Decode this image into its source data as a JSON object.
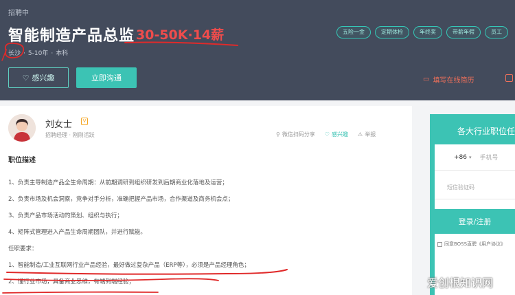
{
  "header": {
    "status": "招聘中",
    "title": "智能制造产品总监",
    "salary": "30-50K·14薪",
    "meta": {
      "city": "长沙",
      "experience": "5-10年",
      "education": "本科"
    },
    "tags": [
      "五险一金",
      "定期体检",
      "年终奖",
      "带薪年假",
      "员工"
    ],
    "interest_label": "感兴趣",
    "chat_label": "立即沟通",
    "fill_resume_label": "填写在线简历"
  },
  "recruiter": {
    "name": "刘女士",
    "role": "招聘经理",
    "activity": "刚刚活跃",
    "share_label": "微信扫码分享",
    "interest_label": "感兴趣",
    "report_label": "举报"
  },
  "description": {
    "section_title": "职位描述",
    "lines": [
      "1、负责主导制造产品全生命周期：从前期调研到组织研发到后期商业化落地及运营；",
      "2、负责市场及机会洞察，竞争对手分析，准确把握产品市场，合作渠道及商务机会点；",
      "3、负责产品市场活动的策划、组织与执行；",
      "4、矩阵式管理进入产品生命周期团队，并进行赋能。",
      "任职要求：",
      "1、智能制造/工业互联网行业产品经验，最好做过复杂产品（ERP等），必须是产品经理角色；",
      "2、懂行业市场，具备商业思维，有端到端经验；"
    ]
  },
  "sidebar": {
    "title": "各大行业职位任",
    "phone_code": "+86",
    "phone_placeholder": "手机号",
    "sms_placeholder": "短信验证码",
    "login_label": "登录/注册",
    "agree_text": "同意BOSS直聘《用户协议》"
  },
  "watermark": "爱创根知识网",
  "colors": {
    "header_bg": "#434b5c",
    "accent": "#3cc3b4",
    "salary": "#f04c4c",
    "annotation": "#e02a2a"
  }
}
